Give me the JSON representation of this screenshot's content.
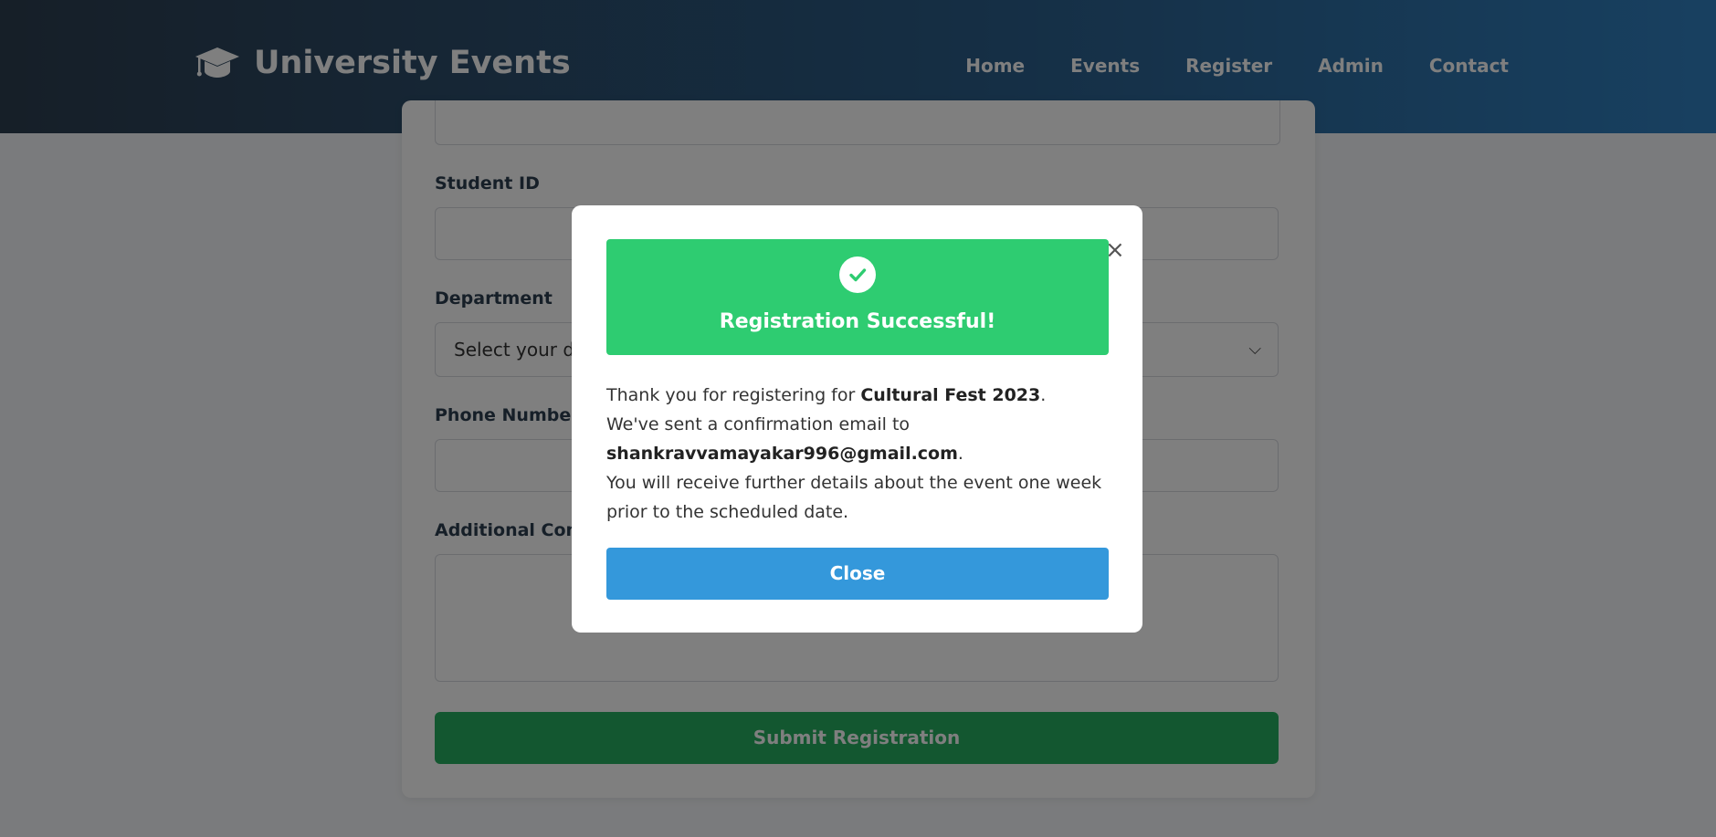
{
  "header": {
    "brand": "University Events",
    "brand_icon": "graduation-cap-icon",
    "nav": [
      "Home",
      "Events",
      "Register",
      "Admin",
      "Contact"
    ]
  },
  "form": {
    "student_id_label": "Student ID",
    "department_label": "Department",
    "department_placeholder": "Select your department",
    "phone_label": "Phone Number",
    "comments_label": "Additional Comments",
    "submit_label": "Submit Registration"
  },
  "modal": {
    "title": "Registration Successful!",
    "icon": "check-circle-icon",
    "message_prefix": "Thank you for registering for ",
    "event_name": "Cultural Fest 2023",
    "email_prefix": "We've sent a confirmation email to",
    "email": "shankravvamayakar996@gmail.com",
    "details": "You will receive further details about the event one week prior to the scheduled date.",
    "close_label": "Close",
    "close_x": "×"
  },
  "colors": {
    "success": "#2ecc71",
    "primary": "#3498db",
    "submit": "#27ae60"
  }
}
